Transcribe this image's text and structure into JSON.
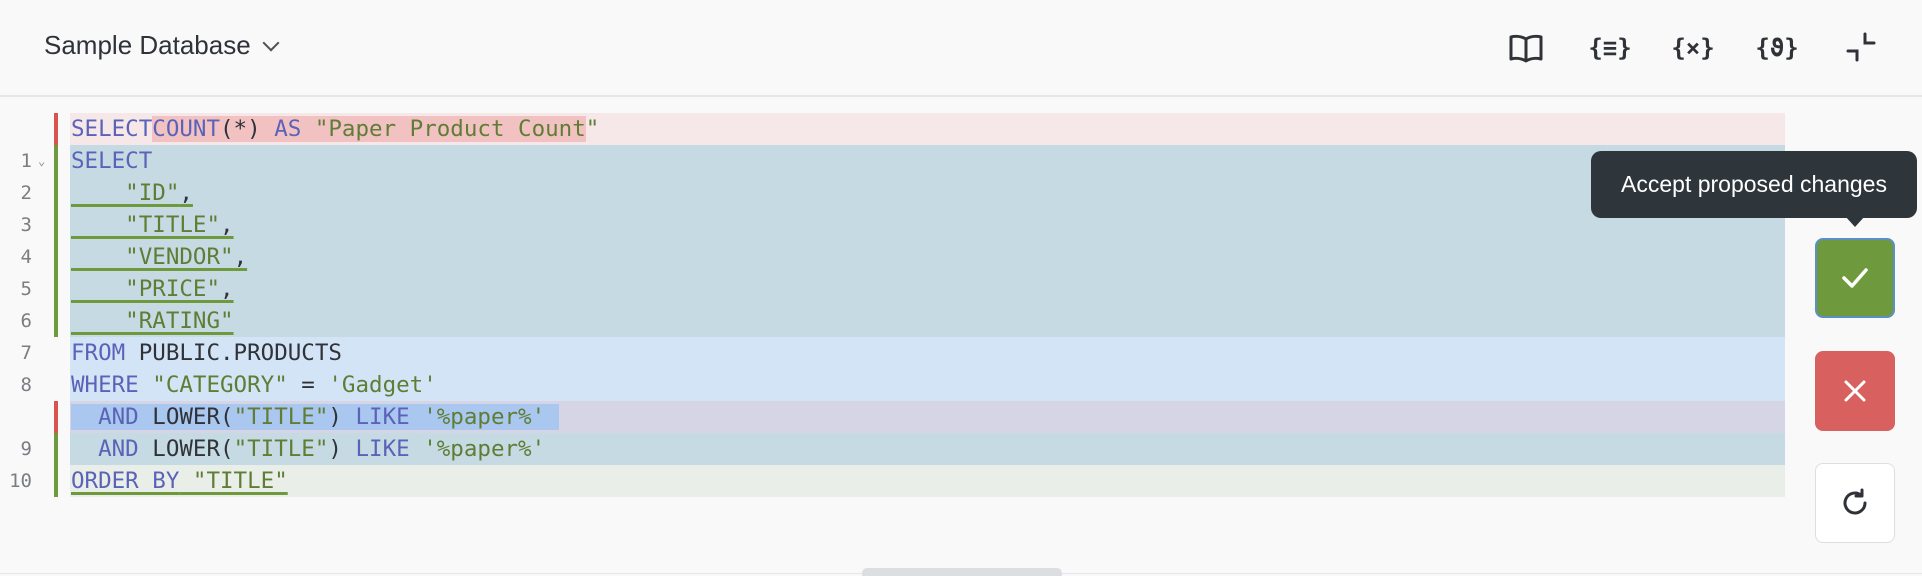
{
  "header": {
    "database_name": "Sample Database",
    "tools": [
      {
        "name": "book-icon",
        "label": "reference"
      },
      {
        "name": "snippets-icon",
        "glyph": "{≡}"
      },
      {
        "name": "variables-icon",
        "glyph": "{×}"
      },
      {
        "name": "ai-icon",
        "glyph": "{ϑ}"
      },
      {
        "name": "collapse-icon"
      }
    ]
  },
  "editor": {
    "line_numbers": [
      "1",
      "2",
      "3",
      "4",
      "5",
      "6",
      "7",
      "8",
      "9",
      "10"
    ],
    "removed_line_1": {
      "kw1": "SELECT",
      "kw2": "COUNT",
      "mid": "(*) ",
      "kw3": "AS",
      "str": " \"Paper Product Count",
      "tail": "\""
    },
    "l1": {
      "kw": "SELECT"
    },
    "l2": {
      "text": "    \"ID\"",
      "punct": ","
    },
    "l3": {
      "text": "    \"TITLE\"",
      "punct": ","
    },
    "l4": {
      "text": "    \"VENDOR\"",
      "punct": ","
    },
    "l5": {
      "text": "    \"PRICE\"",
      "punct": ","
    },
    "l6": {
      "text": "    \"RATING\""
    },
    "l7": {
      "kw": "FROM",
      "rest": " PUBLIC.PRODUCTS"
    },
    "l8": {
      "kw": "WHERE",
      "str1": " \"CATEGORY\"",
      "op": " = ",
      "str2": "'Gadget'"
    },
    "removed_line_2": {
      "kw": "AND",
      "fn": " LOWER(",
      "str1": "\"TITLE\"",
      "close": ") ",
      "kw2": "LIKE",
      "str2": " '%paper%'"
    },
    "l9": {
      "kw": "AND",
      "fn": " LOWER(",
      "str1": "\"TITLE\"",
      "close": ") ",
      "kw2": "LIKE",
      "str2": " '%paper%'"
    },
    "l10": {
      "kw": "ORDER BY",
      "str": " \"TITLE\""
    }
  },
  "actions": {
    "accept_tooltip": "Accept proposed changes",
    "accept_icon": "check-icon",
    "reject_icon": "close-icon",
    "reset_icon": "refresh-icon"
  },
  "colors": {
    "accept": "#6e9a3d",
    "reject": "#d8605e",
    "removed_bar": "#d9534f",
    "added_bar": "#6e9a3d",
    "keyword": "#5b63b8",
    "string": "#5f7d34"
  }
}
